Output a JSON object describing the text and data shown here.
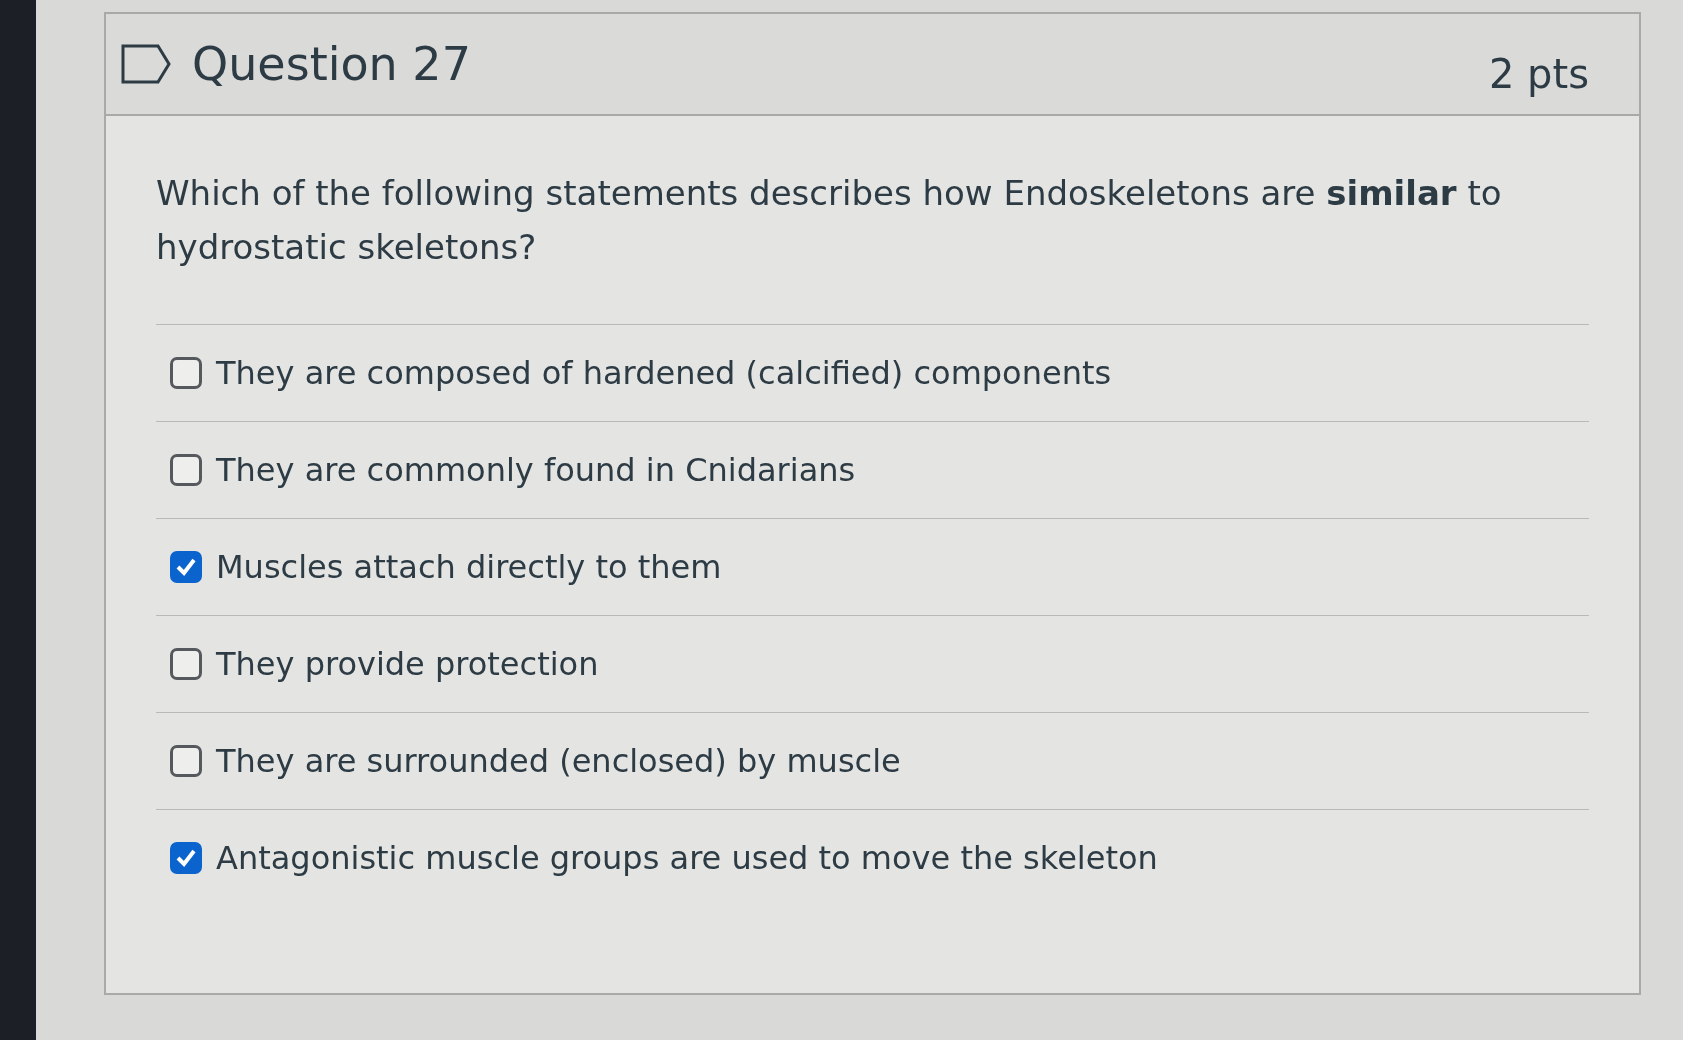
{
  "question": {
    "title": "Question 27",
    "points": "2 pts",
    "text": "Which of the following statements describes how Endoskeletons are **similar** to hydrostatic skeletons?",
    "answers": [
      {
        "label": "They are composed of hardened (calcified) components",
        "checked": false
      },
      {
        "label": "They are commonly found in Cnidarians",
        "checked": false
      },
      {
        "label": "Muscles attach directly to them",
        "checked": true
      },
      {
        "label": "They provide protection",
        "checked": false
      },
      {
        "label": "They are surrounded (enclosed) by muscle",
        "checked": false
      },
      {
        "label": "Antagonistic muscle groups are used to move the skeleton",
        "checked": true
      }
    ]
  }
}
